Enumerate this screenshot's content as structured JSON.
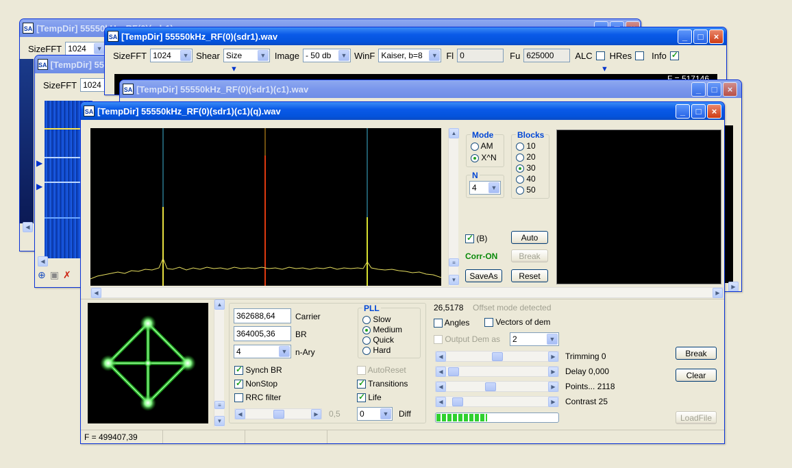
{
  "app_icon": "SA",
  "windows": {
    "w1": {
      "title": "[TempDir] 55550kHz_RF(0)(sdr1).wav",
      "sizefft_label": "SizeFFT",
      "sizefft_value": "1024"
    },
    "w2": {
      "title": "[TempDir] 55550kHz_RF(0)(sdr1).wav",
      "sizefft_label": "SizeFFT",
      "sizefft_value": "1024"
    },
    "w3": {
      "title": "[TempDir] 55550kHz_RF(0)(sdr1).wav",
      "sizefft_label": "SizeFFT",
      "sizefft_value": "1024",
      "shear_label": "Shear",
      "shear_value": "Size",
      "image_label": "Image",
      "image_value": "- 50 db",
      "winf_label": "WinF",
      "winf_value": "Kaiser, b=8",
      "fl_label": "Fl",
      "fl_value": "0",
      "fu_label": "Fu",
      "fu_value": "625000",
      "alc_label": "ALC",
      "hres_label": "HRes",
      "info_label": "Info",
      "freq_readout": "F = 517146"
    },
    "w4": {
      "title": "[TempDir] 55550kHz_RF(0)(sdr1)(c1).wav"
    },
    "main": {
      "title": "[TempDir] 55550kHz_RF(0)(sdr1)(c1)(q).wav",
      "mode": {
        "legend": "Mode",
        "options": [
          "AM",
          "X^N"
        ],
        "selected": "X^N"
      },
      "blocks": {
        "legend": "Blocks",
        "options": [
          "10",
          "20",
          "30",
          "40",
          "50"
        ],
        "selected": "30"
      },
      "n": {
        "legend": "N",
        "value": "4"
      },
      "b_check_label": "(B)",
      "corr_on": "Corr-ON",
      "auto_btn": "Auto",
      "break_btn": "Break",
      "saveas_btn": "SaveAs",
      "reset_btn": "Reset",
      "carrier_value": "362688,64",
      "carrier_label": "Carrier",
      "br_value": "364005,36",
      "br_label": "BR",
      "nary_value": "4",
      "nary_label": "n-Ary",
      "pll": {
        "legend": "PLL",
        "options": [
          "Slow",
          "Medium",
          "Quick",
          "Hard"
        ],
        "selected": "Medium"
      },
      "synch_br": "Synch BR",
      "nonstop": "NonStop",
      "rrc_filter": "RRC filter",
      "autoreset": "AutoReset",
      "transitions": "Transitions",
      "life": "Life",
      "slider_value_label": "0,5",
      "diff_value": "0",
      "diff_label": "Diff",
      "offset_value": "26,5178",
      "offset_msg": "Offset mode detected",
      "angles": "Angles",
      "vectors_of_dem": "Vectors of dem",
      "output_dem_as": "Output Dem as",
      "output_dem_value": "2",
      "trimming": "Trimming 0",
      "delay": "Delay  0,000",
      "points": "Points... 2118",
      "contrast": "Contrast 25",
      "break2_btn": "Break",
      "clear_btn": "Clear",
      "loadfile_btn": "LoadFile",
      "progress_fraction": 0.42,
      "status_freq": "F = 499407,39"
    }
  }
}
